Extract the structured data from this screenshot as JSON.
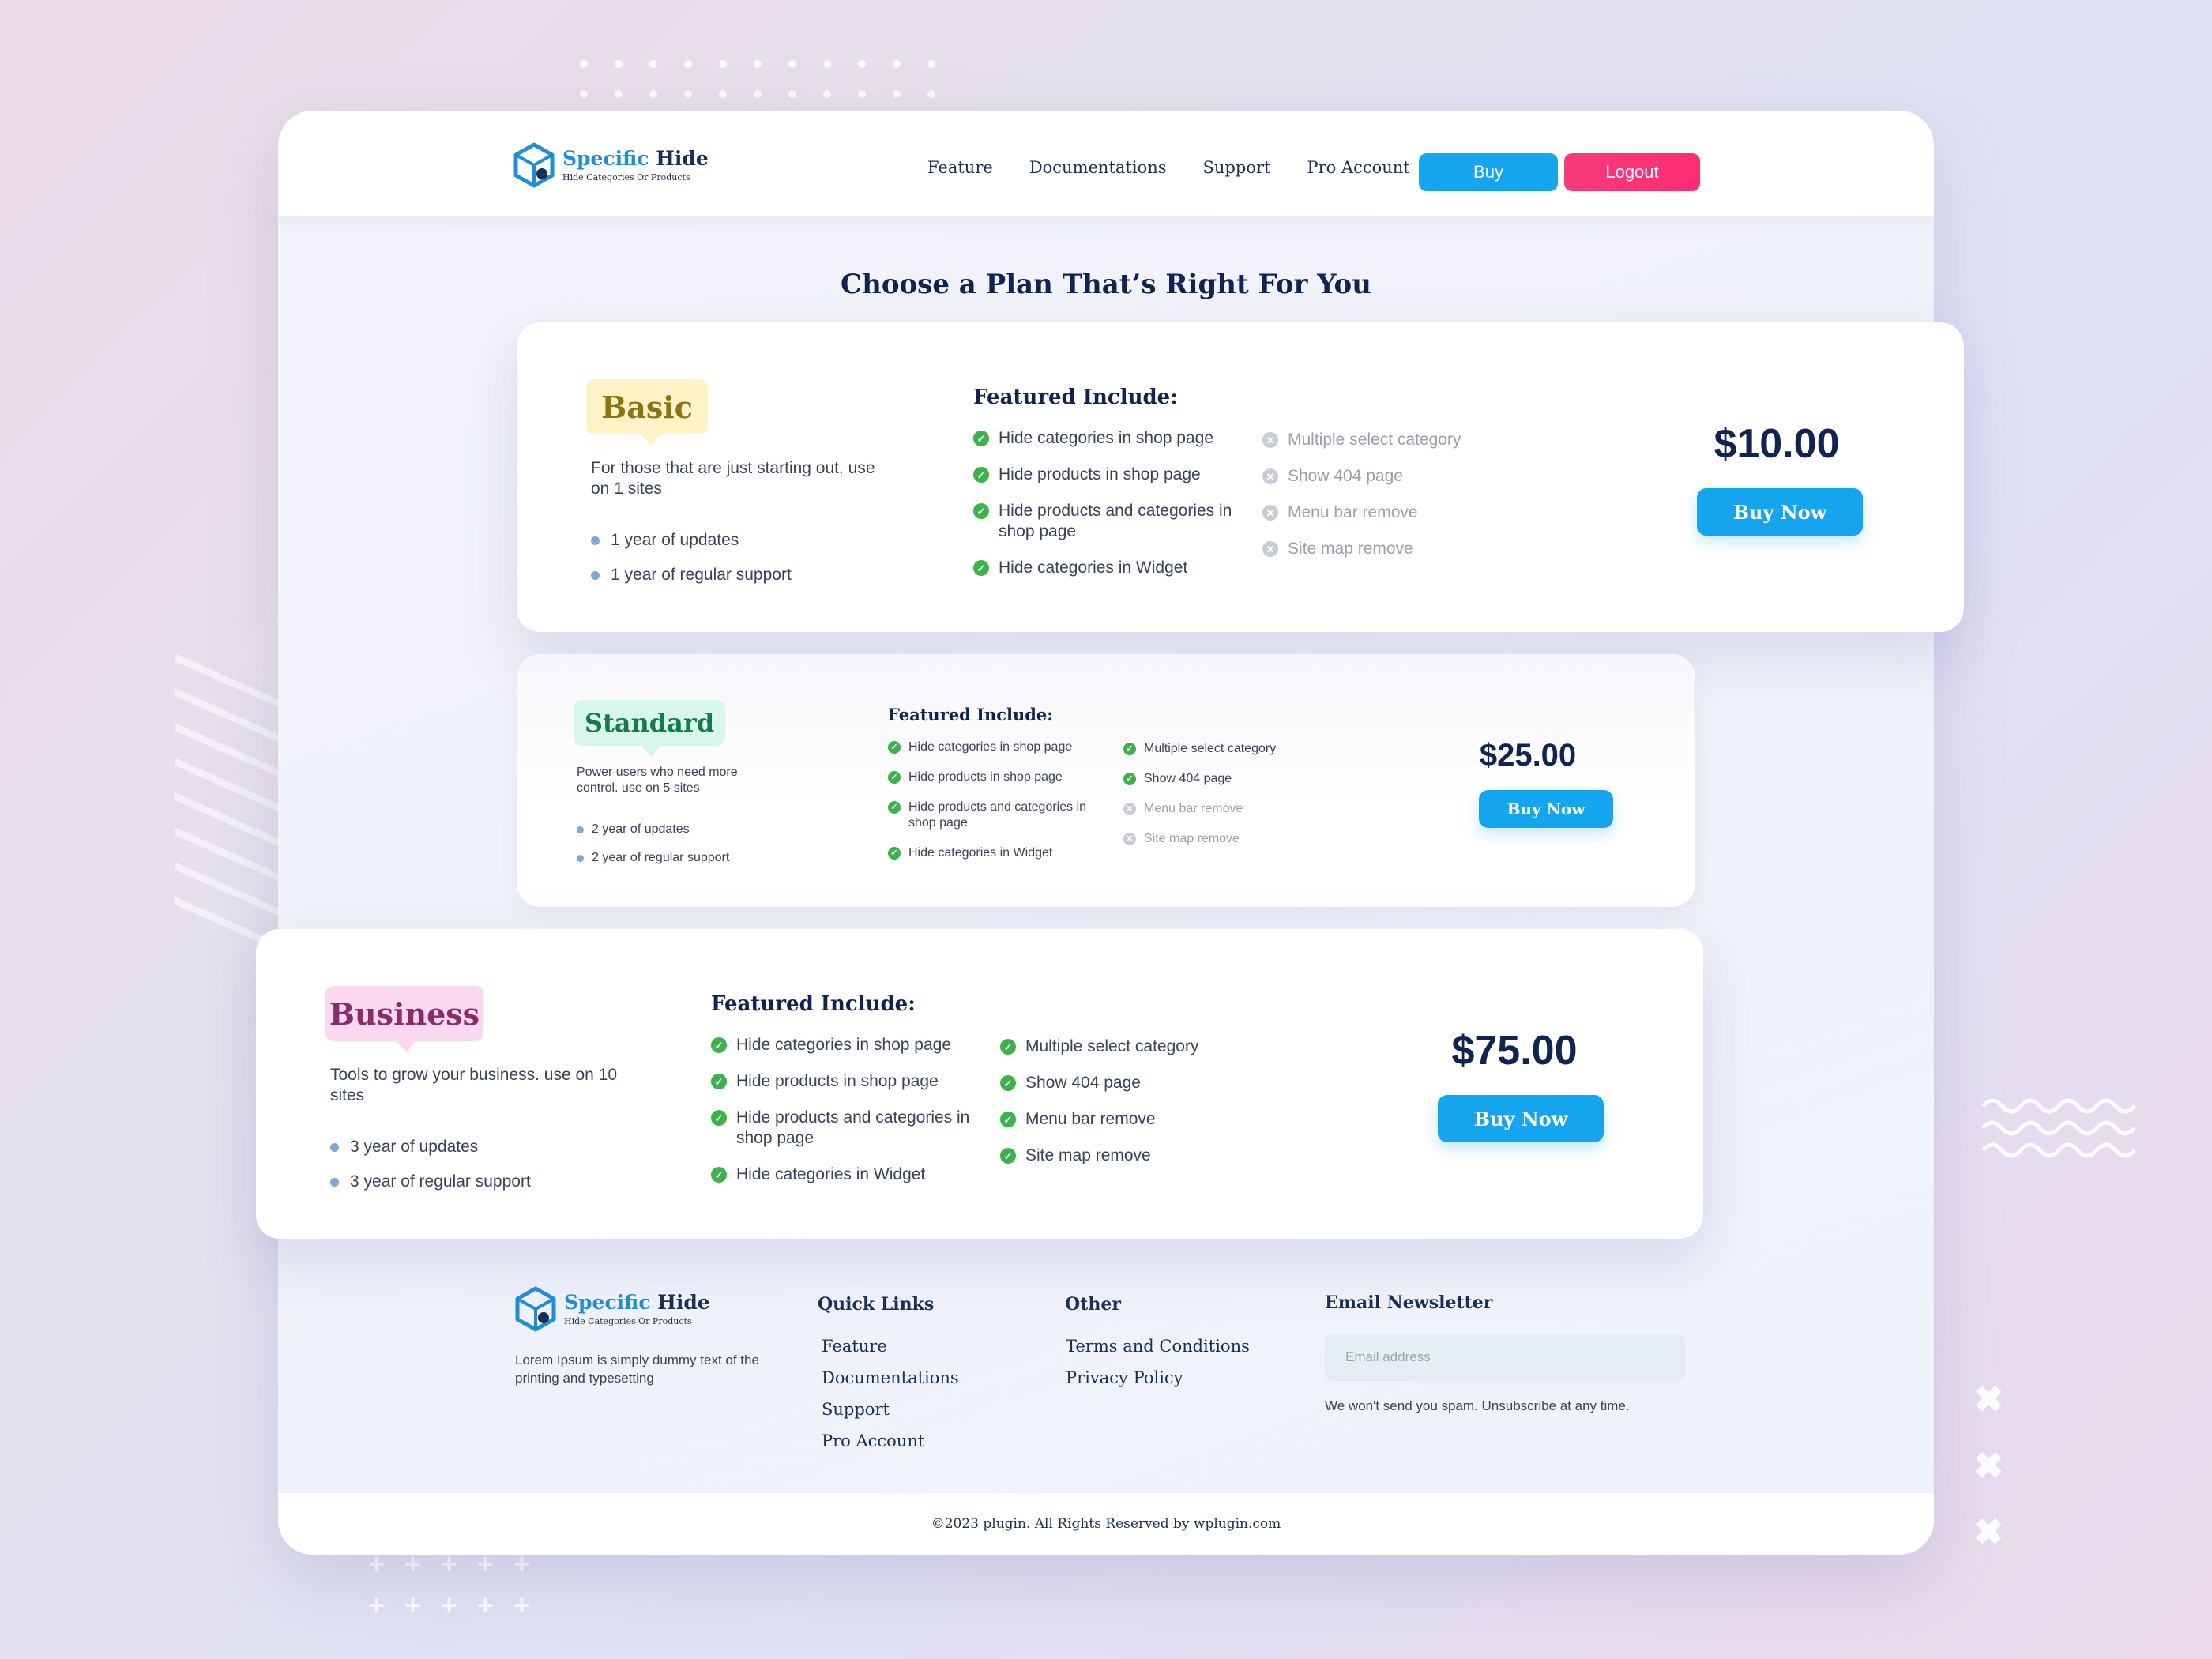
{
  "colors": {
    "accent": "#14a5ee",
    "logout": "#fe2c73",
    "check_on": "#3bb34a",
    "check_off": "#c8ccd3",
    "heading": "#0f2452"
  },
  "brand": {
    "name_part1": "Specific",
    "name_part2": "Hide",
    "tagline": "Hide Categories Or Products",
    "icon": "cube-logo-icon"
  },
  "nav": {
    "items": [
      "Feature",
      "Documentations",
      "Support",
      "Pro Account"
    ],
    "buy_label": "Buy",
    "logout_label": "Logout"
  },
  "page_title": "Choose a Plan That’s Right For You",
  "plans": [
    {
      "name": "Basic",
      "description": "For those that are just starting out. use on 1 sites",
      "perks": [
        "1 year of updates",
        "1 year of regular support"
      ],
      "features_title": "Featured Include:",
      "features_col1": [
        {
          "text": "Hide categories in shop page",
          "included": true
        },
        {
          "text": "Hide products in shop page",
          "included": true
        },
        {
          "text": "Hide products and categories in shop page",
          "included": true
        },
        {
          "text": "Hide categories in Widget",
          "included": true
        }
      ],
      "features_col2": [
        {
          "text": "Multiple select category",
          "included": false
        },
        {
          "text": "Show 404 page",
          "included": false
        },
        {
          "text": "Menu bar remove",
          "included": false
        },
        {
          "text": "Site map remove",
          "included": false
        }
      ],
      "price": "$10.00",
      "cta": "Buy Now"
    },
    {
      "name": "Standard",
      "description": "Power users who need more control. use on 5 sites",
      "perks": [
        "2 year of updates",
        "2 year of regular support"
      ],
      "features_title": "Featured Include:",
      "features_col1": [
        {
          "text": "Hide categories in shop page",
          "included": true
        },
        {
          "text": "Hide products in shop page",
          "included": true
        },
        {
          "text": "Hide products and categories in shop page",
          "included": true
        },
        {
          "text": "Hide categories in Widget",
          "included": true
        }
      ],
      "features_col2": [
        {
          "text": "Multiple select category",
          "included": true
        },
        {
          "text": "Show 404 page",
          "included": true
        },
        {
          "text": "Menu bar remove",
          "included": false
        },
        {
          "text": "Site map remove",
          "included": false
        }
      ],
      "price": "$25.00",
      "cta": "Buy Now"
    },
    {
      "name": "Business",
      "description": "Tools to grow your business. use on 10 sites",
      "perks": [
        "3 year of updates",
        "3 year of regular support"
      ],
      "features_title": "Featured Include:",
      "features_col1": [
        {
          "text": "Hide categories in shop page",
          "included": true
        },
        {
          "text": "Hide products in shop page",
          "included": true
        },
        {
          "text": "Hide products and categories in shop page",
          "included": true
        },
        {
          "text": "Hide categories in Widget",
          "included": true
        }
      ],
      "features_col2": [
        {
          "text": "Multiple select category",
          "included": true
        },
        {
          "text": "Show 404 page",
          "included": true
        },
        {
          "text": "Menu bar remove",
          "included": true
        },
        {
          "text": "Site map remove",
          "included": true
        }
      ],
      "price": "$75.00",
      "cta": "Buy Now"
    }
  ],
  "footer": {
    "about": "Lorem Ipsum is simply dummy text of the printing and typesetting",
    "quick_links_title": "Quick Links",
    "quick_links": [
      "Feature",
      "Documentations",
      "Support",
      "Pro Account"
    ],
    "other_title": "Other",
    "other_links": [
      "Terms and Conditions",
      "Privacy Policy"
    ],
    "newsletter_title": "Email Newsletter",
    "email_placeholder": "Email address",
    "spam_note": "We won't send you spam. Unsubscribe at any time.",
    "copyright": "©2023 plugin. All Rights Reserved by wplugin.com"
  }
}
